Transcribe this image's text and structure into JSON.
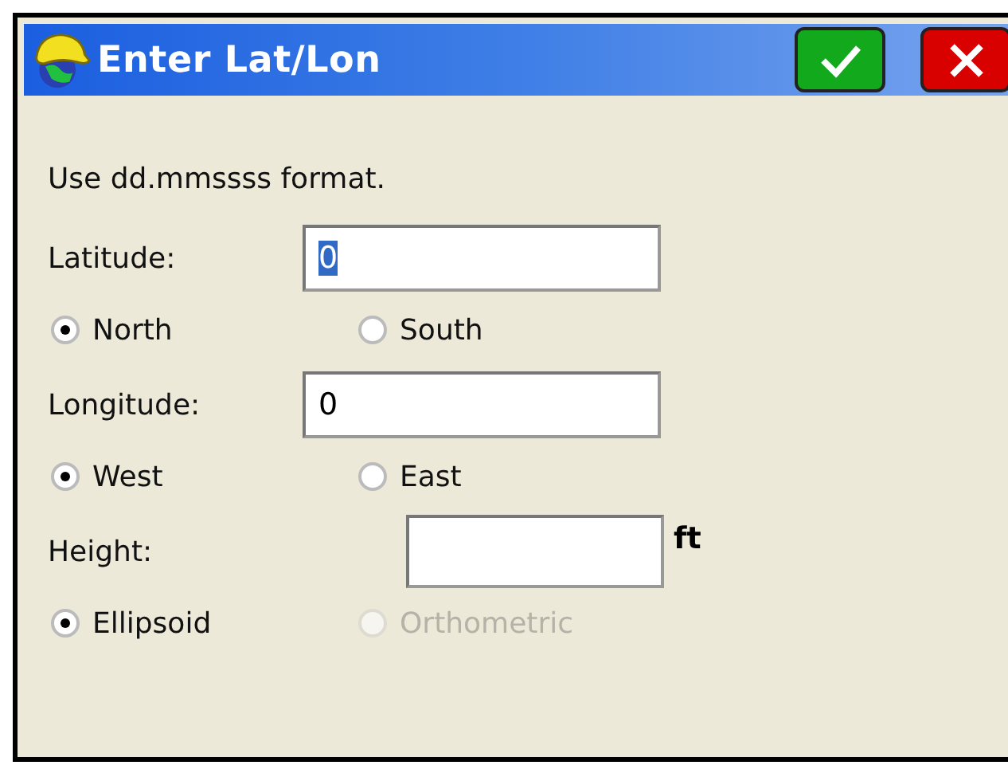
{
  "window": {
    "title": "Enter Lat/Lon",
    "buttons": [
      {
        "kind": "ok"
      },
      {
        "kind": "cancel"
      }
    ]
  },
  "instruction": "Use dd.mmssss format.",
  "sections": [
    {
      "label": "Latitude:",
      "field": {
        "value": "0",
        "text_selected": true
      },
      "options": [
        {
          "label": "North",
          "selected": true,
          "disabled": false
        },
        {
          "label": "South",
          "selected": false,
          "disabled": false
        }
      ]
    },
    {
      "label": "Longitude:",
      "field": {
        "value": "0",
        "text_selected": false
      },
      "options": [
        {
          "label": "West",
          "selected": true,
          "disabled": false
        },
        {
          "label": "East",
          "selected": false,
          "disabled": false
        }
      ]
    },
    {
      "label": "Height:",
      "unit": "ft",
      "options": [
        {
          "label": "Ellipsoid",
          "selected": true,
          "disabled": false
        },
        {
          "label": "Orthometric",
          "selected": false,
          "disabled": true
        }
      ]
    }
  ]
}
